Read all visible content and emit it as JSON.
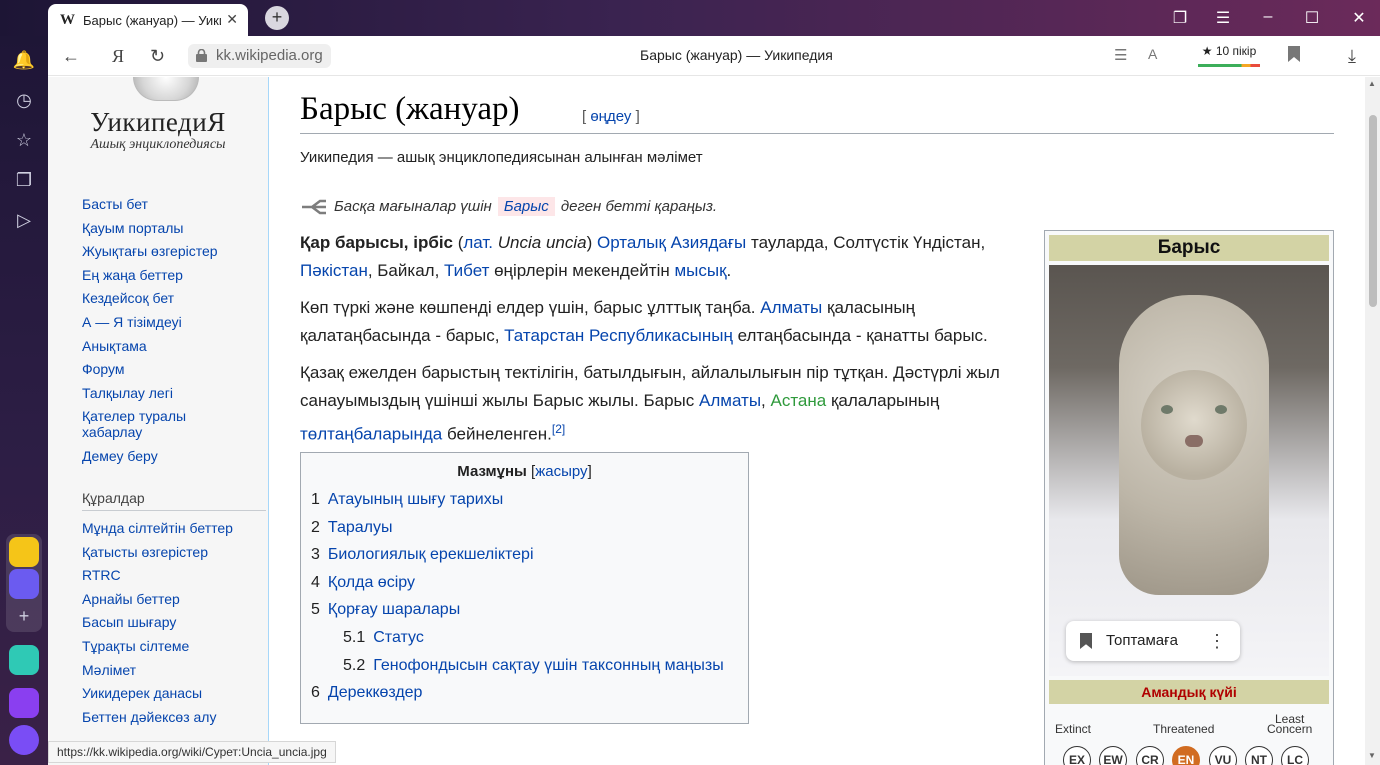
{
  "browser": {
    "tab_title": "Барыс (жануар) — Уикипедия",
    "tab_favicon": "W",
    "url": "kk.wikipedia.org",
    "page_title": "Барыс (жануар) — Уикипедия",
    "reviews": "★ 10 пікір",
    "status_url": "https://kk.wikipedia.org/wiki/Сурет:Uncia_uncia.jpg"
  },
  "wiki": {
    "logo_text": "УикипедиЯ",
    "logo_sub": "Ашық энциклопедиясы",
    "nav": [
      "Басты бет",
      "Қауым порталы",
      "Жуықтағы өзгерістер",
      "Ең жаңа беттер",
      "Кездейсоқ бет",
      "А — Я тізімдеуі",
      "Анықтама",
      "Форум",
      "Талқылау легі",
      "Қателер туралы хабарлау",
      "Демеу беру"
    ],
    "tools_heading": "Құралдар",
    "tools": [
      "Мұнда сілтейтін беттер",
      "Қатысты өзгерістер",
      "RTRC",
      "Арнайы беттер",
      "Басып шығару",
      "Тұрақты сілтеме",
      "Мәлімет",
      "Уикидерек данасы",
      "Беттен дәйексөз алу"
    ]
  },
  "article": {
    "title": "Барыс (жануар)",
    "edit_open": "[ ",
    "edit_label": "өңдеу",
    "edit_close": " ]",
    "from": "Уикипедия — ашық энциклопедиясынан алынған мәлімет",
    "hatnote_before": "Басқа мағыналар үшін",
    "hatnote_link": "Барыс",
    "hatnote_after": "деген бетті қараңыз.",
    "p1": {
      "bold": "Қар барысы, ірбіс",
      "t1": " (",
      "lat": "лат.",
      "t2": " ",
      "species": "Uncia uncia",
      "t3": ") ",
      "l_central": "Орталық Азиядағы",
      "t4": " тауларда, Солтүстік Үндістан, ",
      "l_pak": "Пәкістан",
      "t5": ", Байкал, ",
      "l_tibet": "Тибет",
      "t6": " өңірлерін мекендейтін ",
      "l_cat": "мысық",
      "t7": "."
    },
    "p2": {
      "t1": "Көп түркі және көшпенді елдер үшін, барыс ұлттық таңба. ",
      "l_almaty": "Алматы",
      "t2": " қаласының қалатаңбасында - барыс, ",
      "l_tatar": "Татарстан Республикасының",
      "t3": " елтаңбасында - қанатты барыс."
    },
    "p3": {
      "t1": "Қазақ ежелден барыстың тектілігін, батылдығын, айлалылығын пір тұтқан. Дәстүрлі жыл санауымыздың үшінші жылы Барыс жылы. Барыс ",
      "l_almaty": "Алматы",
      "t2": ", ",
      "l_astana": "Астана",
      "t3": " қалаларының ",
      "l_emblems": "төлтаңбаларында",
      "t4": " бейнеленген.",
      "ref": "[2]"
    },
    "toc": {
      "title": "Мазмұны",
      "hide_open": " [",
      "hide_label": "жасыру",
      "hide_close": "]",
      "items": [
        {
          "num": "1",
          "label": "Атауының шығу тарихы"
        },
        {
          "num": "2",
          "label": "Таралуы"
        },
        {
          "num": "3",
          "label": "Биологиялық ерекшеліктері"
        },
        {
          "num": "4",
          "label": "Қолда өсіру"
        },
        {
          "num": "5",
          "label": "Қорғау шаралары"
        },
        {
          "num": "5.1",
          "label": "Статус"
        },
        {
          "num": "5.2",
          "label": "Генофондысын сақтау үшін таксонның маңызы"
        },
        {
          "num": "6",
          "label": "Дереккөздер"
        }
      ]
    },
    "infobox": {
      "title": "Барыс",
      "bookmark_label": "Топтамаға",
      "status_heading": "Амандық күйі",
      "scale_extinct": "Extinct",
      "scale_threatened": "Threatened",
      "scale_least": "Least",
      "scale_concern": "Concern",
      "scale": [
        "EX",
        "EW",
        "CR",
        "EN",
        "VU",
        "NT",
        "LC"
      ]
    }
  },
  "colors": {
    "link": "#0645ad",
    "infobox_header": "#d3d3a5",
    "status_en": "#d16c21"
  }
}
